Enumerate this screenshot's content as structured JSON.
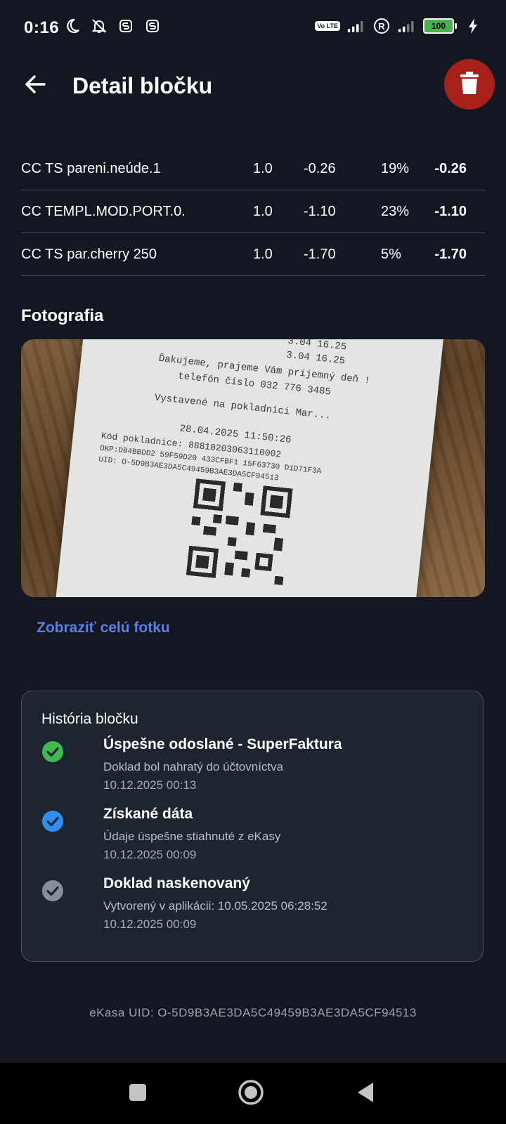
{
  "status_bar": {
    "time": "0:16",
    "icons_left": [
      "moon-icon",
      "bell-off-icon",
      "s-icon",
      "s-icon"
    ],
    "volte": "Vo LTE",
    "battery_level": "100",
    "battery_color": "#4caf50"
  },
  "header": {
    "title": "Detail bločku",
    "back_icon": "arrow-left-icon",
    "delete_icon": "trash-icon",
    "delete_color": "#a8201a"
  },
  "items": [
    {
      "name": "CC TS pareni.neúde.1",
      "qty": "1.0",
      "price": "-0.26",
      "vat": "19%",
      "total": "-0.26"
    },
    {
      "name": "CC TEMPL.MOD.PORT.0.",
      "qty": "1.0",
      "price": "-1.10",
      "vat": "23%",
      "total": "-1.10"
    },
    {
      "name": "CC TS par.cherry 250",
      "qty": "1.0",
      "price": "-1.70",
      "vat": "5%",
      "total": "-1.70"
    }
  ],
  "photo": {
    "label": "Fotografia",
    "receipt_lines": [
      "3.04        16.25",
      "3.04        16.25",
      "Ďakujeme, prajeme Vám príjemný deň !",
      "telefón číslo  032 776 3485",
      "Vystavené na pokladnici Mar...",
      "28.04.2025 11:50:26",
      "Kód pokladnice: 88810203063110002",
      "OKP:DB4BBDD2 59F59D20 433CFBF1 15F63730 D1D71F3A",
      "UID: O-5D9B3AE3DA5C49459B3AE3DA5CF94513"
    ],
    "show_full_link": "Zobraziť celú fotku"
  },
  "history": {
    "title": "História bločku",
    "entries": [
      {
        "icon": "check-circle-green-icon",
        "title": "Úspešne odoslané - SuperFaktura",
        "desc": "Doklad bol nahratý do účtovníctva",
        "time": "10.12.2025 00:13",
        "color": "#3fb950"
      },
      {
        "icon": "check-circle-blue-icon",
        "title": "Získané dáta",
        "desc": "Údaje úspešne stiahnuté z eKasy",
        "time": "10.12.2025 00:09",
        "color": "#2f8ef0"
      },
      {
        "icon": "check-circle-grey-icon",
        "title": "Doklad naskenovaný",
        "desc": "Vytvorený v aplikácii: 10.05.2025 06:28:52",
        "time": "10.12.2025 00:09",
        "color": "#8a8e96"
      }
    ]
  },
  "footer": {
    "ekasa_uid": "eKasa UID: O-5D9B3AE3DA5C49459B3AE3DA5CF94513"
  },
  "navbar": {
    "buttons": [
      "recents-square-icon",
      "home-circle-icon",
      "back-triangle-icon"
    ]
  }
}
